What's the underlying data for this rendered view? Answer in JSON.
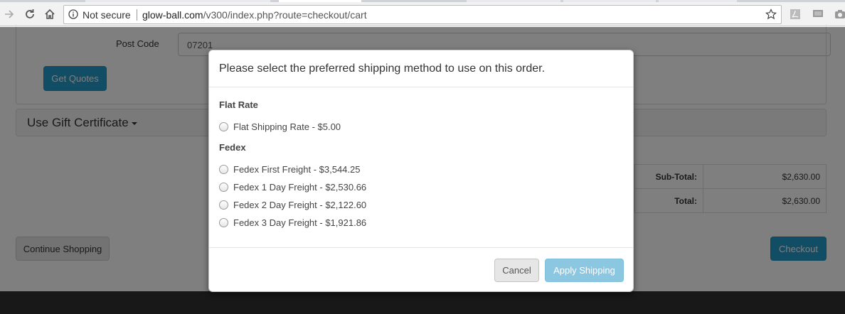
{
  "browser": {
    "security_label": "Not secure",
    "url_host": "glow-ball.com",
    "url_path": "/v300/index.php?route=checkout/cart",
    "icons": [
      "forward-icon",
      "reload-icon",
      "home-icon",
      "info-icon",
      "star-icon",
      "pdf-extension-icon",
      "chat-extension-icon",
      "camera-extension-icon"
    ]
  },
  "page": {
    "postcode_label": "Post Code",
    "postcode_value": "07201",
    "get_quotes": "Get Quotes",
    "gift_certificate": "Use Gift Certificate",
    "totals": [
      {
        "label": "Sub-Total:",
        "value": "$2,630.00"
      },
      {
        "label": "Total:",
        "value": "$2,630.00"
      }
    ],
    "continue_shopping": "Continue Shopping",
    "checkout": "Checkout"
  },
  "modal": {
    "title": "Please select the preferred shipping method to use on this order.",
    "groups": [
      {
        "title": "Flat Rate",
        "options": [
          "Flat Shipping Rate - $5.00"
        ]
      },
      {
        "title": "Fedex",
        "options": [
          "Fedex First Freight - $3,544.25",
          "Fedex 1 Day Freight - $2,530.66",
          "Fedex 2 Day Freight - $2,122.60",
          "Fedex 3 Day Freight - $1,921.86"
        ]
      }
    ],
    "cancel": "Cancel",
    "apply": "Apply Shipping"
  },
  "colors": {
    "primary": "#229ac8",
    "primary_disabled": "#8cc7e2",
    "backdrop": "rgba(0,0,0,0.5)",
    "footer": "#303030"
  }
}
